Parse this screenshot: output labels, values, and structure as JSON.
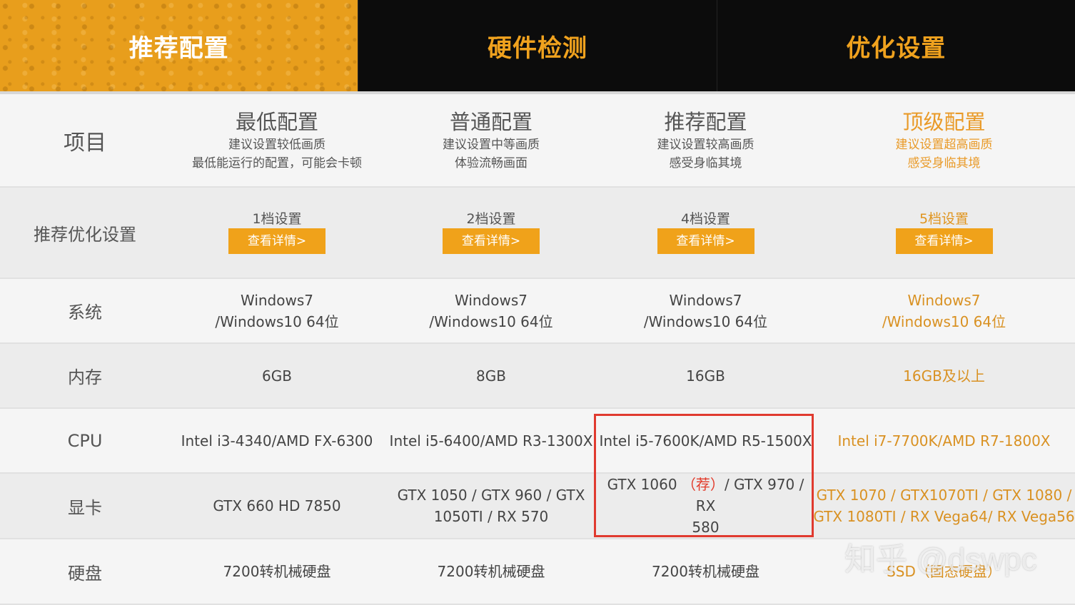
{
  "tabs": [
    "推荐配置",
    "硬件检测",
    "优化设置"
  ],
  "header": {
    "item_label": "项目",
    "columns": [
      {
        "title": "最低配置",
        "line1": "建议设置较低画质",
        "line2": "最低能运行的配置，可能会卡顿"
      },
      {
        "title": "普通配置",
        "line1": "建议设置中等画质",
        "line2": "体验流畅画面"
      },
      {
        "title": "推荐配置",
        "line1": "建议设置较高画质",
        "line2": "感受身临其境"
      },
      {
        "title": "顶级配置",
        "line1": "建议设置超高画质",
        "line2": "感受身临其境"
      }
    ]
  },
  "optimize_row": {
    "label": "推荐优化设置",
    "tiers": [
      "1档设置",
      "2档设置",
      "4档设置",
      "5档设置"
    ],
    "button_label": "查看详情>"
  },
  "rows": {
    "os": {
      "label": "系统",
      "values": [
        [
          "Windows7",
          "/Windows10 64位"
        ],
        [
          "Windows7",
          "/Windows10 64位"
        ],
        [
          "Windows7",
          "/Windows10 64位"
        ],
        [
          "Windows7",
          "/Windows10 64位"
        ]
      ]
    },
    "ram": {
      "label": "内存",
      "values": [
        "6GB",
        "8GB",
        "16GB",
        "16GB及以上"
      ]
    },
    "cpu": {
      "label": "CPU",
      "values": [
        "Intel i3-4340/AMD FX-6300",
        "Intel i5-6400/AMD R3-1300X",
        "Intel i5-7600K/AMD R5-1500X",
        "Intel i7-7700K/AMD R7-1800X"
      ]
    },
    "gpu": {
      "label": "显卡",
      "values": [
        [
          "GTX 660 HD 7850",
          ""
        ],
        [
          "GTX 1050 / GTX 960 / GTX",
          "1050TI / RX 570"
        ],
        [
          "GTX 1060",
          "（荐）",
          "/ GTX 970 / RX",
          "580"
        ],
        [
          "GTX 1070 / GTX1070TI / GTX 1080 /",
          "GTX 1080TI / RX Vega64/ RX Vega56"
        ]
      ]
    },
    "disk": {
      "label": "硬盘",
      "values": [
        "7200转机械硬盘",
        "7200转机械硬盘",
        "7200转机械硬盘",
        "SSD（固态硬盘）"
      ]
    }
  },
  "watermark": "知乎 @dswpc",
  "colors": {
    "accent": "#f0a21a",
    "top_tier_text": "#e99a28",
    "highlight_border": "#e03a2f"
  }
}
